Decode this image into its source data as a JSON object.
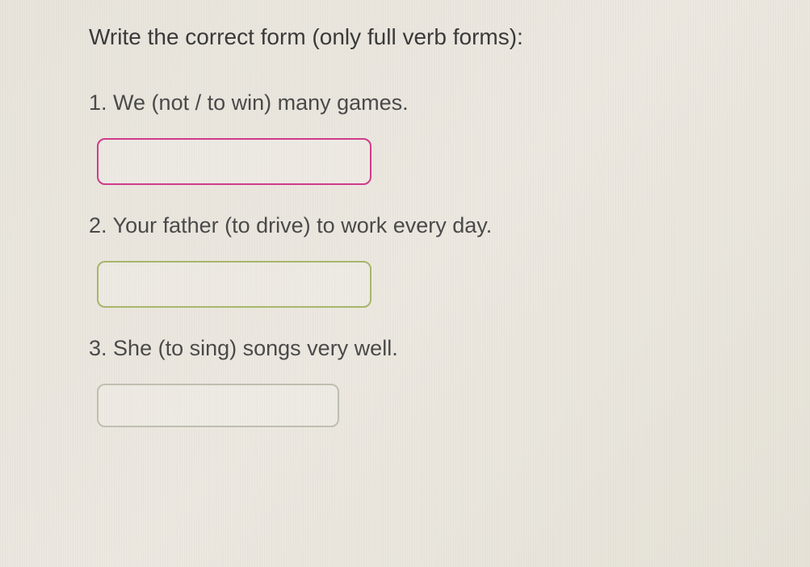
{
  "instruction": "Write the correct form (only full verb forms):",
  "questions": [
    {
      "number": "1.",
      "text": "We (not / to win) many games.",
      "value": ""
    },
    {
      "number": "2.",
      "text": "Your father (to drive) to work every day.",
      "value": ""
    },
    {
      "number": "3.",
      "text": "She (to sing) songs very well.",
      "value": ""
    }
  ]
}
